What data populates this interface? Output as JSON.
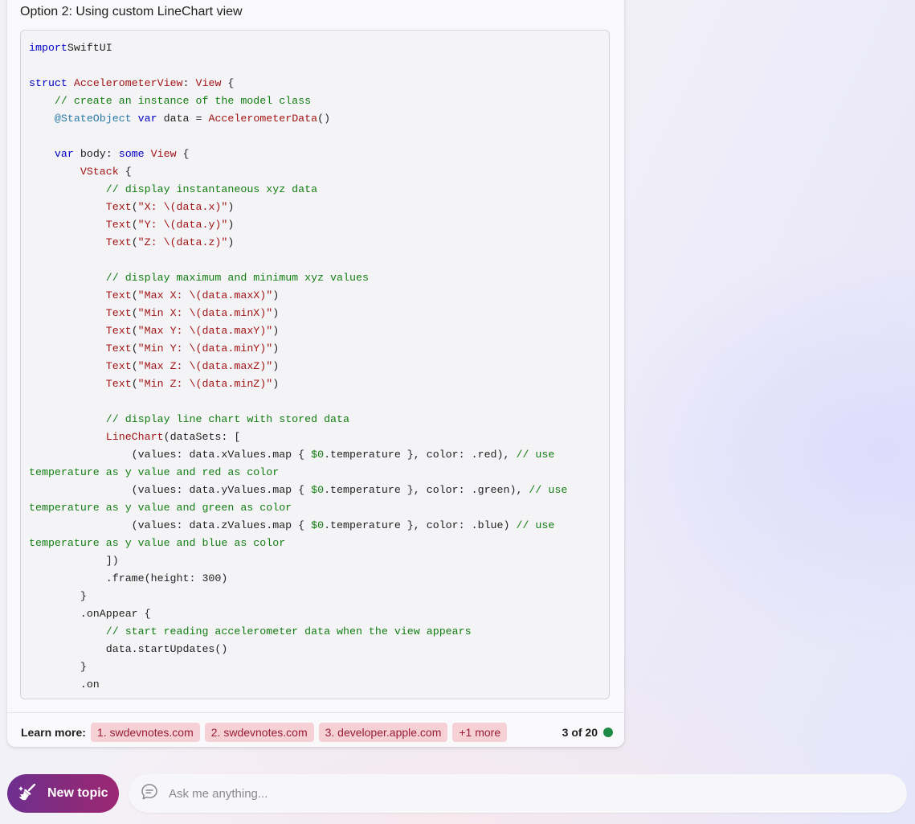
{
  "response": {
    "option_title": "Option 2: Using custom LineChart view",
    "code_lines": [
      [
        [
          "kw",
          "import"
        ],
        [
          "",
          "SwiftUI"
        ]
      ],
      [],
      [
        [
          "kw",
          "struct"
        ],
        [
          "",
          " "
        ],
        [
          "ty",
          "AccelerometerView"
        ],
        [
          "",
          ": "
        ],
        [
          "ty",
          "View"
        ],
        [
          "",
          " {"
        ]
      ],
      [
        [
          "",
          "    "
        ],
        [
          "cm",
          "// create an instance of the model class"
        ]
      ],
      [
        [
          "",
          "    "
        ],
        [
          "pp",
          "@StateObject"
        ],
        [
          "",
          " "
        ],
        [
          "kw",
          "var"
        ],
        [
          "",
          " data = "
        ],
        [
          "ty",
          "AccelerometerData"
        ],
        [
          "",
          "()"
        ]
      ],
      [],
      [
        [
          "",
          "    "
        ],
        [
          "kw",
          "var"
        ],
        [
          "",
          " body: "
        ],
        [
          "kw",
          "some"
        ],
        [
          "",
          " "
        ],
        [
          "ty",
          "View"
        ],
        [
          "",
          " {"
        ]
      ],
      [
        [
          "",
          "        "
        ],
        [
          "ty",
          "VStack"
        ],
        [
          "",
          " {"
        ]
      ],
      [
        [
          "",
          "            "
        ],
        [
          "cm",
          "// display instantaneous xyz data"
        ]
      ],
      [
        [
          "",
          "            "
        ],
        [
          "ty",
          "Text"
        ],
        [
          "",
          "("
        ],
        [
          "st",
          "\"X: \\(data.x)\""
        ],
        [
          "",
          ")"
        ]
      ],
      [
        [
          "",
          "            "
        ],
        [
          "ty",
          "Text"
        ],
        [
          "",
          "("
        ],
        [
          "st",
          "\"Y: \\(data.y)\""
        ],
        [
          "",
          ")"
        ]
      ],
      [
        [
          "",
          "            "
        ],
        [
          "ty",
          "Text"
        ],
        [
          "",
          "("
        ],
        [
          "st",
          "\"Z: \\(data.z)\""
        ],
        [
          "",
          ")"
        ]
      ],
      [],
      [
        [
          "",
          "            "
        ],
        [
          "cm",
          "// display maximum and minimum xyz values"
        ]
      ],
      [
        [
          "",
          "            "
        ],
        [
          "ty",
          "Text"
        ],
        [
          "",
          "("
        ],
        [
          "st",
          "\"Max X: \\(data.maxX)\""
        ],
        [
          "",
          ")"
        ]
      ],
      [
        [
          "",
          "            "
        ],
        [
          "ty",
          "Text"
        ],
        [
          "",
          "("
        ],
        [
          "st",
          "\"Min X: \\(data.minX)\""
        ],
        [
          "",
          ")"
        ]
      ],
      [
        [
          "",
          "            "
        ],
        [
          "ty",
          "Text"
        ],
        [
          "",
          "("
        ],
        [
          "st",
          "\"Max Y: \\(data.maxY)\""
        ],
        [
          "",
          ")"
        ]
      ],
      [
        [
          "",
          "            "
        ],
        [
          "ty",
          "Text"
        ],
        [
          "",
          "("
        ],
        [
          "st",
          "\"Min Y: \\(data.minY)\""
        ],
        [
          "",
          ")"
        ]
      ],
      [
        [
          "",
          "            "
        ],
        [
          "ty",
          "Text"
        ],
        [
          "",
          "("
        ],
        [
          "st",
          "\"Max Z: \\(data.maxZ)\""
        ],
        [
          "",
          ")"
        ]
      ],
      [
        [
          "",
          "            "
        ],
        [
          "ty",
          "Text"
        ],
        [
          "",
          "("
        ],
        [
          "st",
          "\"Min Z: \\(data.minZ)\""
        ],
        [
          "",
          ")"
        ]
      ],
      [],
      [
        [
          "",
          "            "
        ],
        [
          "cm",
          "// display line chart with stored data"
        ]
      ],
      [
        [
          "",
          "            "
        ],
        [
          "ty",
          "LineChart"
        ],
        [
          "",
          "(dataSets: ["
        ]
      ],
      [
        [
          "",
          "                (values: data.xValues.map { "
        ],
        [
          "cm",
          "$0"
        ],
        [
          "",
          ".temperature }, color: .red), "
        ],
        [
          "cm",
          "// use"
        ]
      ],
      [
        [
          "cm",
          "temperature as y value and red as color"
        ]
      ],
      [
        [
          "",
          "                (values: data.yValues.map { "
        ],
        [
          "cm",
          "$0"
        ],
        [
          "",
          ".temperature }, color: .green), "
        ],
        [
          "cm",
          "// use"
        ]
      ],
      [
        [
          "cm",
          "temperature as y value and green as color"
        ]
      ],
      [
        [
          "",
          "                (values: data.zValues.map { "
        ],
        [
          "cm",
          "$0"
        ],
        [
          "",
          ".temperature }, color: .blue) "
        ],
        [
          "cm",
          "// use"
        ]
      ],
      [
        [
          "cm",
          "temperature as y value and blue as color"
        ]
      ],
      [
        [
          "",
          "            ])"
        ]
      ],
      [
        [
          "",
          "            .frame(height: 300)"
        ]
      ],
      [
        [
          "",
          "        }"
        ]
      ],
      [
        [
          "",
          "        .onAppear {"
        ]
      ],
      [
        [
          "",
          "            "
        ],
        [
          "cm",
          "// start reading accelerometer data when the view appears"
        ]
      ],
      [
        [
          "",
          "            data.startUpdates()"
        ]
      ],
      [
        [
          "",
          "        }"
        ]
      ],
      [
        [
          "",
          "        .on"
        ]
      ]
    ],
    "learn_more": {
      "label": "Learn more:",
      "links": [
        "1. swdevnotes.com",
        "2. swdevnotes.com",
        "3. developer.apple.com",
        "+1 more"
      ]
    },
    "counter": "3 of 20"
  },
  "composer": {
    "new_topic_label": "New topic",
    "placeholder": "Ask me anything..."
  },
  "colors": {
    "chip_bg": "#f5d1d6",
    "chip_text": "#9b1c34",
    "status_dot": "#1f8a45",
    "new_topic_gradient_start": "#6e2f8f",
    "new_topic_gradient_end": "#9c2774"
  },
  "icons": {
    "new_topic": "broom-sparkle-icon",
    "composer": "chat-bubble-icon",
    "status": "status-dot"
  }
}
